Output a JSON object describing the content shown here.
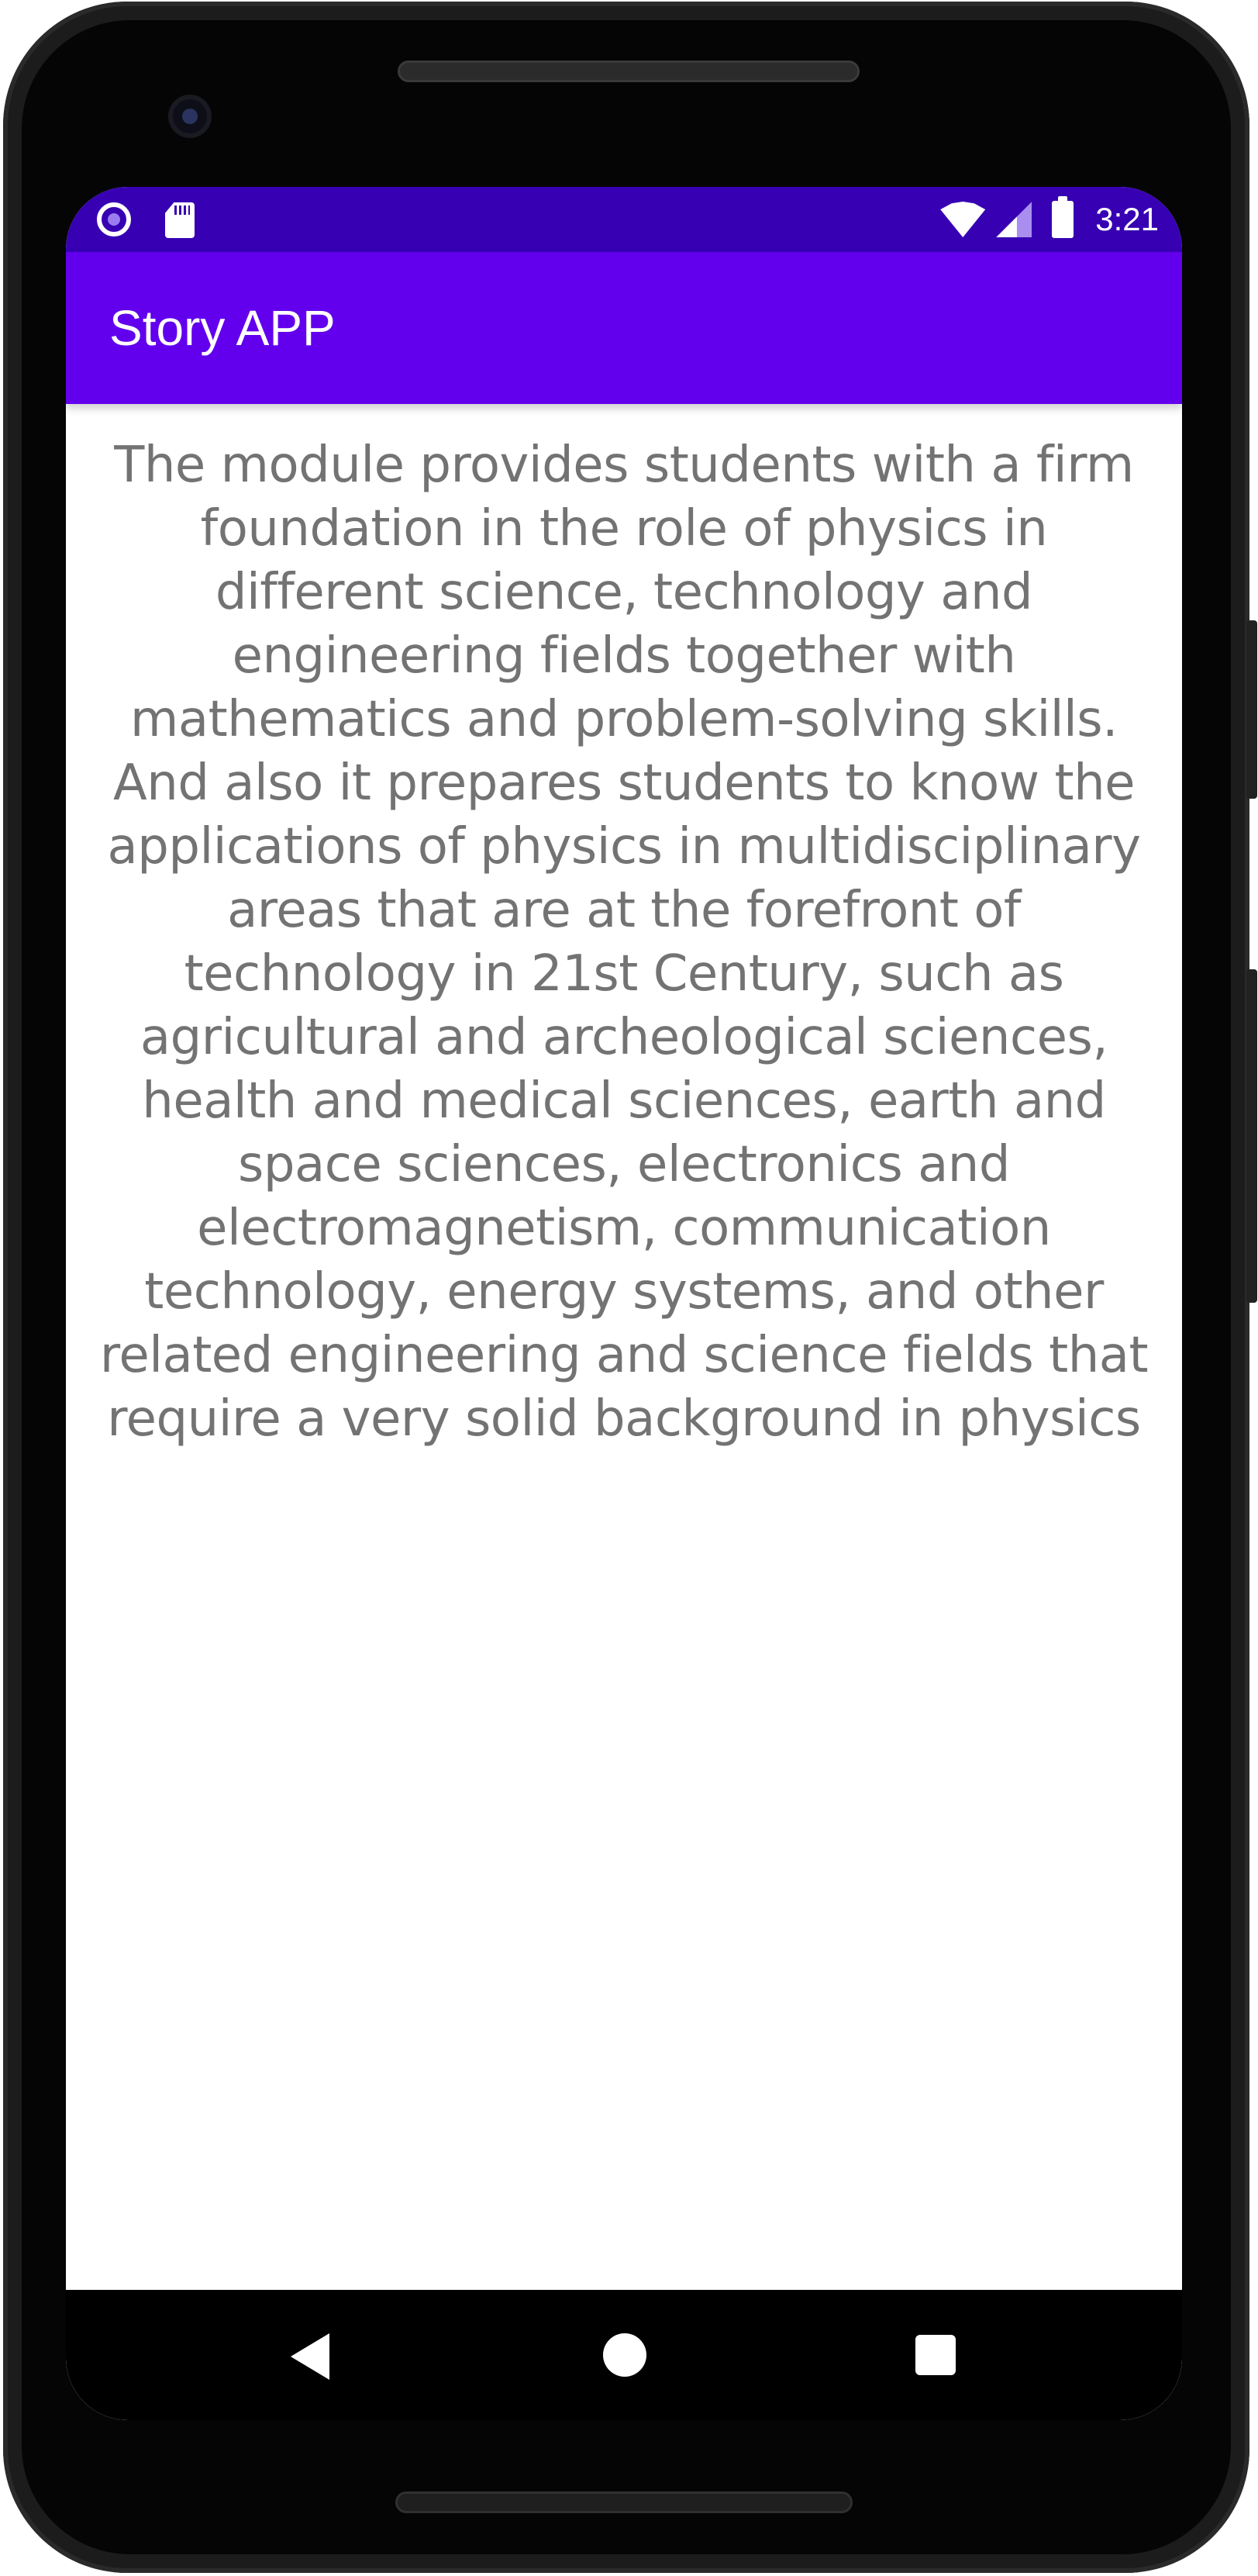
{
  "status_bar": {
    "time": "3:21",
    "icons": [
      "notification-circle-icon",
      "sd-card-icon",
      "wifi-icon",
      "signal-icon",
      "battery-icon"
    ]
  },
  "app_bar": {
    "title": "Story APP",
    "color": "#6200ee",
    "status_color": "#3700b3"
  },
  "content": {
    "story": "The module provides students with a firm foundation in the role of physics in different science, technology and engineering fields together with mathematics and problem-solving skills. And also it prepares students to know the applications of physics in multidisciplinary areas that are at the forefront of technology in 21st Century, such as agricultural and archeological sciences, health and medical sciences, earth and space sciences, electronics and electromagnetism, communication technology, energy systems, and other related engineering and science fields that require a very solid background in physics"
  },
  "nav_bar": {
    "buttons": [
      "back-icon",
      "home-icon",
      "recents-icon"
    ]
  }
}
